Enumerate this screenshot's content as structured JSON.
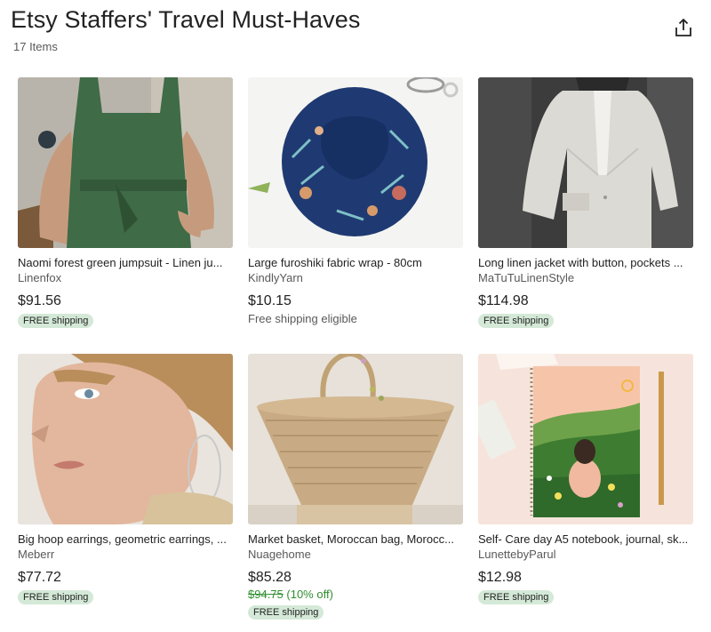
{
  "page": {
    "title": "Etsy Staffers' Travel Must-Haves",
    "item_count": "17 Items"
  },
  "items": [
    {
      "image": "green-linen-jumpsuit-photo",
      "title": "Naomi forest green jumpsuit - Linen ju...",
      "shop": "Linenfox",
      "price": "$91.56",
      "shipping": "FREE shipping"
    },
    {
      "image": "furoshiki-wrap-photo",
      "title": "Large furoshiki fabric wrap - 80cm",
      "shop": "KindlyYarn",
      "price": "$10.15",
      "shipping": "Free shipping eligible"
    },
    {
      "image": "linen-jacket-photo",
      "title": "Long linen jacket with button, pockets ...",
      "shop": "MaTuTuLinenStyle",
      "price": "$114.98",
      "shipping": "FREE shipping"
    },
    {
      "image": "hoop-earrings-photo",
      "title": "Big hoop earrings, geometric earrings, ...",
      "shop": "Meberr",
      "price": "$77.72",
      "shipping": "FREE shipping"
    },
    {
      "image": "market-basket-photo",
      "title": "Market basket, Moroccan bag, Morocc...",
      "shop": "Nuagehome",
      "price": "$85.28",
      "original_price": "$94.75",
      "discount": "(10% off)",
      "shipping": "FREE shipping"
    },
    {
      "image": "notebook-photo",
      "title": "Self- Care day A5 notebook, journal, sk...",
      "shop": "LunettebyParul",
      "price": "$12.98",
      "shipping": "FREE shipping"
    }
  ],
  "colors": {
    "badge_bg": "#d4e9d7",
    "sale_green": "#2f8f2f",
    "muted_text": "#595959"
  }
}
